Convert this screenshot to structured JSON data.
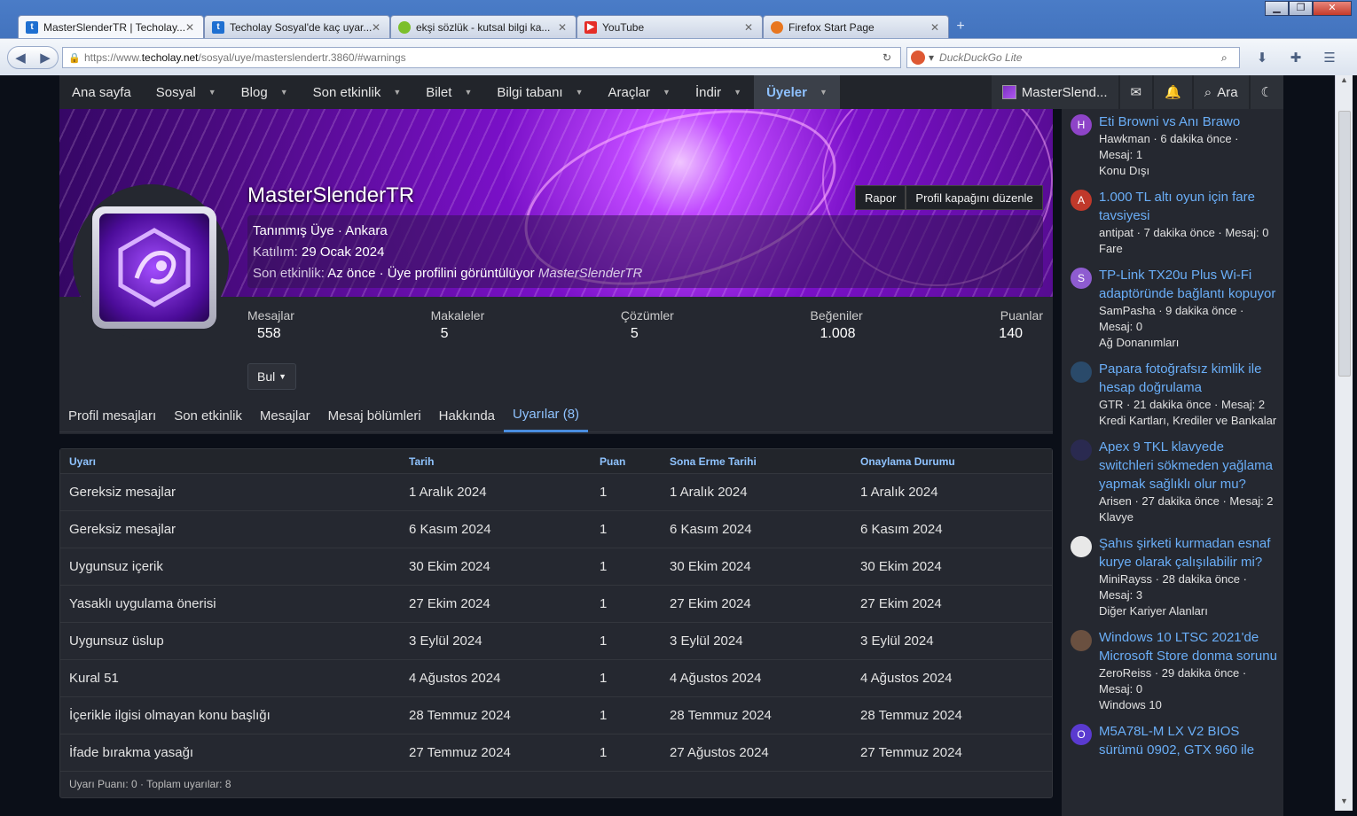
{
  "browser": {
    "tabs": [
      {
        "title": "MasterSlenderTR | Techolay...",
        "icon": "techolay-t",
        "color": "#1e6fd1",
        "active": true
      },
      {
        "title": "Techolay Sosyal'de kaç uyar...",
        "icon": "techolay-t",
        "color": "#1e6fd1",
        "active": false
      },
      {
        "title": "ekşi sözlük - kutsal bilgi ka...",
        "icon": "eksi-drop",
        "color": "#7bbf2a",
        "active": false
      },
      {
        "title": "YouTube",
        "icon": "youtube-play",
        "color": "#e52d27",
        "active": false
      },
      {
        "title": "Firefox Start Page",
        "icon": "firefox-logo",
        "color": "#e8761f",
        "active": false
      }
    ],
    "url_prefix": "https://www.",
    "url_domain": "techolay.net",
    "url_path": "/sosyal/uye/masterslendertr.3860/#warnings",
    "search_placeholder": "DuckDuckGo Lite"
  },
  "site_nav": {
    "items": [
      "Ana sayfa",
      "Sosyal",
      "Blog",
      "Son etkinlik",
      "Bilet",
      "Bilgi tabanı",
      "Araçlar",
      "İndir",
      "Üyeler"
    ],
    "selected": "Üyeler",
    "user": "MasterSlend...",
    "search_label": "Ara"
  },
  "profile": {
    "username": "MasterSlenderTR",
    "report_btn": "Rapor",
    "edit_cover_btn": "Profil kapağını düzenle",
    "title_line": "Tanınmış Üye · Ankara",
    "joined_label": "Katılım:",
    "joined_value": "29 Ocak 2024",
    "last_activity_label": "Son etkinlik:",
    "last_activity_value": "Az önce",
    "last_activity_detail": "· Üye profilini görüntülüyor",
    "last_activity_target": "MasterSlenderTR",
    "stats": [
      {
        "label": "Mesajlar",
        "value": "558"
      },
      {
        "label": "Makaleler",
        "value": "5"
      },
      {
        "label": "Çözümler",
        "value": "5"
      },
      {
        "label": "Beğeniler",
        "value": "1.008"
      },
      {
        "label": "Puanlar",
        "value": "140"
      }
    ],
    "find_btn": "Bul",
    "tabs": [
      "Profil mesajları",
      "Son etkinlik",
      "Mesajlar",
      "Mesaj bölümleri",
      "Hakkında",
      "Uyarılar (8)"
    ],
    "active_tab": "Uyarılar (8)"
  },
  "warnings": {
    "headers": [
      "Uyarı",
      "Tarih",
      "Puan",
      "Sona Erme Tarihi",
      "Onaylama Durumu"
    ],
    "rows": [
      [
        "Gereksiz mesajlar",
        "1 Aralık 2024",
        "1",
        "1 Aralık 2024",
        "1 Aralık 2024"
      ],
      [
        "Gereksiz mesajlar",
        "6 Kasım 2024",
        "1",
        "6 Kasım 2024",
        "6 Kasım 2024"
      ],
      [
        "Uygunsuz içerik",
        "30 Ekim 2024",
        "1",
        "30 Ekim 2024",
        "30 Ekim 2024"
      ],
      [
        "Yasaklı uygulama önerisi",
        "27 Ekim 2024",
        "1",
        "27 Ekim 2024",
        "27 Ekim 2024"
      ],
      [
        "Uygunsuz üslup",
        "3 Eylül 2024",
        "1",
        "3 Eylül 2024",
        "3 Eylül 2024"
      ],
      [
        "Kural 51",
        "4 Ağustos 2024",
        "1",
        "4 Ağustos 2024",
        "4 Ağustos 2024"
      ],
      [
        "İçerikle ilgisi olmayan konu başlığı",
        "28 Temmuz 2024",
        "1",
        "28 Temmuz 2024",
        "28 Temmuz 2024"
      ],
      [
        "İfade bırakma yasağı",
        "27 Temmuz 2024",
        "1",
        "27 Ağustos 2024",
        "27 Temmuz 2024"
      ]
    ],
    "footer": "Uyarı Puanı: 0 · Toplam uyarılar: 8"
  },
  "sidebar": {
    "threads": [
      {
        "avatar": "H",
        "color": "#8e44c8",
        "title": "Eti Browni vs Anı Brawo",
        "meta": [
          "Hawkman · 6 dakika önce ·",
          "Mesaj: 1",
          "Konu Dışı"
        ]
      },
      {
        "avatar": "A",
        "color": "#c0392b",
        "title": "1.000 TL altı oyun için fare tavsiyesi",
        "meta": [
          "antipat · 7 dakika önce · Mesaj: 0",
          "Fare"
        ]
      },
      {
        "avatar": "S",
        "color": "#8e5cd0",
        "title": "TP-Link TX20u Plus Wi-Fi adaptöründe bağlantı kopuyor",
        "meta": [
          "SamPasha · 9 dakika önce ·",
          "Mesaj: 0",
          "Ağ Donanımları"
        ]
      },
      {
        "avatar": "",
        "color": "#2a4a6a",
        "title": "Papara fotoğrafsız kimlik ile hesap doğrulama",
        "meta": [
          "GTR · 21 dakika önce · Mesaj: 2",
          "Kredi Kartları, Krediler ve Bankalar"
        ]
      },
      {
        "avatar": "",
        "color": "#2a2a50",
        "title": "Apex 9 TKL klavyede switchleri sökmeden yağlama yapmak sağlıklı olur mu?",
        "meta": [
          "Arisen · 27 dakika önce · Mesaj: 2",
          "Klavye"
        ]
      },
      {
        "avatar": "",
        "color": "#e8e8e8",
        "title": "Şahıs şirketi kurmadan esnaf kurye olarak çalışılabilir mi?",
        "meta": [
          "MiniRayss · 28 dakika önce ·",
          "Mesaj: 3",
          "Diğer Kariyer Alanları"
        ]
      },
      {
        "avatar": "",
        "color": "#6a5040",
        "title": "Windows 10 LTSC 2021'de Microsoft Store donma sorunu",
        "meta": [
          "ZeroReiss · 29 dakika önce ·",
          "Mesaj: 0",
          "Windows 10"
        ]
      },
      {
        "avatar": "O",
        "color": "#5a3ad0",
        "title": "M5A78L-M LX V2 BIOS sürümü 0902, GTX 960 ile",
        "meta": []
      }
    ]
  }
}
